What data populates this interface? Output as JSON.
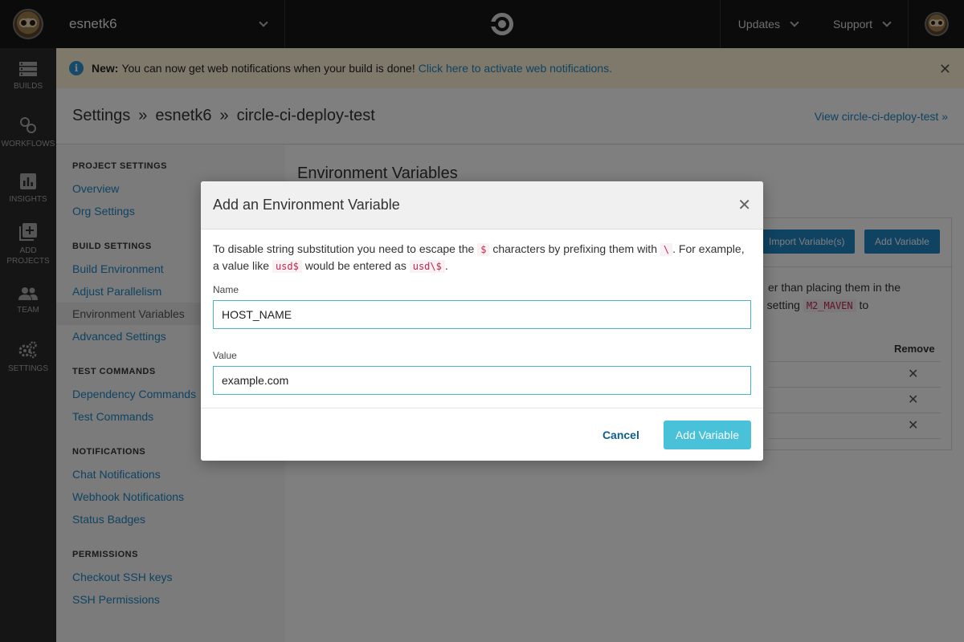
{
  "topbar": {
    "org_name": "esnetk6",
    "updates_label": "Updates",
    "support_label": "Support"
  },
  "leftnav": [
    {
      "label": "BUILDS",
      "icon": "builds-icon"
    },
    {
      "label": "WORKFLOWS",
      "icon": "workflows-icon"
    },
    {
      "label": "INSIGHTS",
      "icon": "insights-icon"
    },
    {
      "label": "ADD PROJECTS",
      "icon": "add-projects-icon"
    },
    {
      "label": "TEAM",
      "icon": "team-icon"
    },
    {
      "label": "SETTINGS",
      "icon": "settings-icon"
    }
  ],
  "banner": {
    "bold": "New:",
    "text": "You can now get web notifications when your build is done!",
    "link": "Click here to activate web notifications."
  },
  "breadcrumb": {
    "root": "Settings",
    "sep": "»",
    "org": "esnetk6",
    "project": "circle-ci-deploy-test",
    "view_link": "View circle-ci-deploy-test »"
  },
  "settings_nav": {
    "project_settings": {
      "title": "PROJECT SETTINGS",
      "items": [
        "Overview",
        "Org Settings"
      ]
    },
    "build_settings": {
      "title": "BUILD SETTINGS",
      "items": [
        "Build Environment",
        "Adjust Parallelism",
        "Environment Variables",
        "Advanced Settings"
      ]
    },
    "test_commands": {
      "title": "TEST COMMANDS",
      "items": [
        "Dependency Commands",
        "Test Commands"
      ]
    },
    "notifications": {
      "title": "NOTIFICATIONS",
      "items": [
        "Chat Notifications",
        "Webhook Notifications",
        "Status Badges"
      ]
    },
    "permissions": {
      "title": "PERMISSIONS",
      "items": [
        "Checkout SSH keys",
        "SSH Permissions"
      ]
    }
  },
  "main": {
    "heading": "Environment Variables",
    "import_button": "Import Variable(s)",
    "add_button": "Add Variable",
    "bg_line1": "er than placing them in the",
    "bg_line2_pre": "as setting",
    "bg_line2_code": "M2_MAVEN",
    "bg_line2_post": "to",
    "remove_header": "Remove",
    "remove_glyph": "✕"
  },
  "modal": {
    "title": "Add an Environment Variable",
    "close_glyph": "✕",
    "desc_1": "To disable string substitution you need to escape the",
    "code_dollar": "$",
    "desc_2": "characters by prefixing them with",
    "code_backslash": "\\",
    "desc_3": ". For example,",
    "desc_4": "a value like",
    "code_example": "usd$",
    "desc_5": "would be entered as",
    "code_escaped": "usd\\$",
    "desc_6": ".",
    "name_label": "Name",
    "name_value": "HOST_NAME",
    "value_label": "Value",
    "value_value": "example.com",
    "cancel_label": "Cancel",
    "add_label": "Add Variable"
  }
}
